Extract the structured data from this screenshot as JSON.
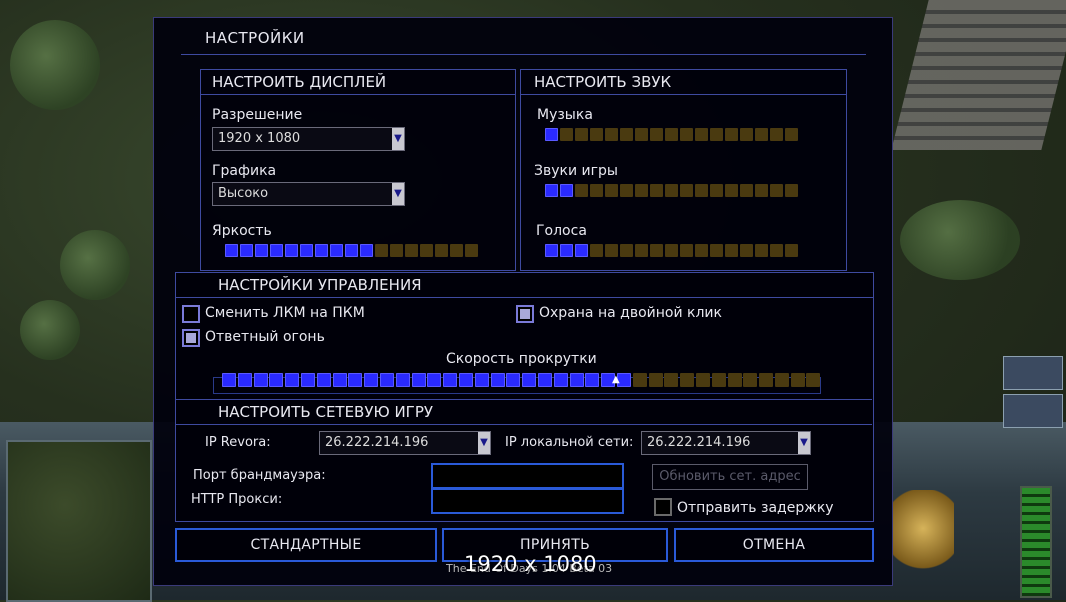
{
  "dialog": {
    "title": "НАСТРОЙКИ"
  },
  "display": {
    "header": "НАСТРОИТЬ ДИСПЛЕЙ",
    "resolution_label": "Разрешение",
    "resolution_value": "1920 x 1080",
    "graphics_label": "Графика",
    "graphics_value": "Высоко",
    "brightness_label": "Яркость",
    "brightness_level": {
      "on": 10,
      "total": 17
    }
  },
  "sound": {
    "header": "НАСТРОИТЬ ЗВУК",
    "music_label": "Музыка",
    "music_level": {
      "on": 1,
      "total": 17
    },
    "effects_label": "Звуки игры",
    "effects_level": {
      "on": 2,
      "total": 17
    },
    "voice_label": "Голоса",
    "voice_level": {
      "on": 3,
      "total": 17
    }
  },
  "controls": {
    "header": "НАСТРОЙКИ УПРАВЛЕНИЯ",
    "swap_mouse_label": "Сменить ЛКМ на ПКМ",
    "swap_mouse_checked": false,
    "double_click_guard_label": "Охрана на двойной клик",
    "double_click_guard_checked": true,
    "retaliation_label": "Ответный огонь",
    "retaliation_checked": true,
    "scroll_speed_label": "Скорость прокрутки",
    "scroll_speed_level": {
      "on": 26,
      "total": 38
    }
  },
  "network": {
    "header": "НАСТРОИТЬ СЕТЕВУЮ ИГРУ",
    "ip_revora_label": "IP Revora:",
    "ip_revora_value": "26.222.214.196",
    "ip_lan_label": "IP локальной сети:",
    "ip_lan_value": "26.222.214.196",
    "firewall_port_label": "Порт брандмауэра:",
    "http_proxy_label": "HTTP Прокси:",
    "refresh_address_button": "Обновить сет. адрес",
    "send_delay_label": "Отправить задержку",
    "send_delay_checked": false
  },
  "buttons": {
    "defaults": "СТАНДАРТНЫЕ",
    "accept": "ПРИНЯТЬ",
    "cancel": "ОТМЕНА"
  },
  "footer": {
    "caption": "The End Of Days 1.04 Beta 03",
    "overlay_resolution": "1920 x 1080"
  },
  "colors": {
    "accent_blue": "#2a5ad8",
    "meter_on": "#2a2aff",
    "meter_off": "#4a3a10",
    "panel_border": "#3e4aa0"
  }
}
